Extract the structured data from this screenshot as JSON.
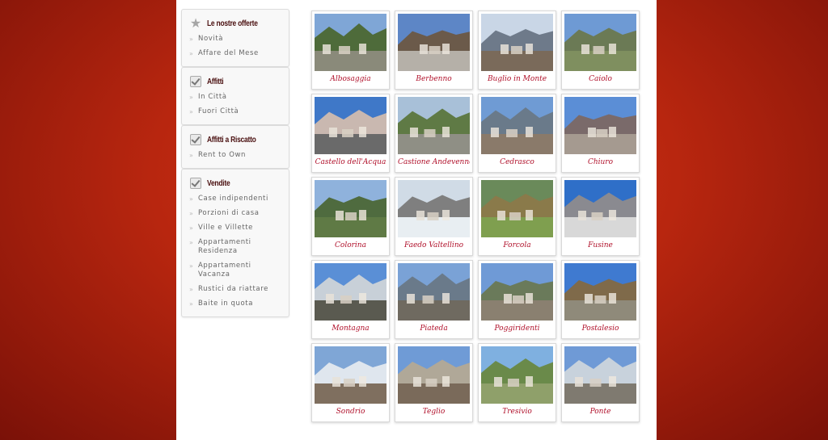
{
  "sidebar": {
    "sections": [
      {
        "icon": "star-icon",
        "title": "Le nostre offerte",
        "items": [
          "Novità",
          "Affare del Mese"
        ]
      },
      {
        "icon": "checkbox-icon",
        "title": "Affitti",
        "items": [
          "In Città",
          "Fuori Città"
        ]
      },
      {
        "icon": "checkbox-icon",
        "title": "Affitti a Riscatto",
        "items": [
          "Rent to Own"
        ]
      },
      {
        "icon": "checkbox-icon",
        "title": "Vendite",
        "items": [
          "Case indipendenti",
          "Porzioni di casa",
          "Ville e Villette",
          "Appartamenti Residenza",
          "Appartamenti Vacanza",
          "Rustici da riattare",
          "Baite in quota"
        ]
      }
    ]
  },
  "towns": [
    {
      "name": "Albosaggia",
      "sky": "#7fa6d6",
      "mid": "#4e6b3a",
      "fg": "#8a8a7a"
    },
    {
      "name": "Berbenno",
      "sky": "#5d86c6",
      "mid": "#6b5a4a",
      "fg": "#b5b0a8"
    },
    {
      "name": "Buglio in Monte",
      "sky": "#c9d6e6",
      "mid": "#6e7a8a",
      "fg": "#7a6a5a"
    },
    {
      "name": "Caiolo",
      "sky": "#6e9ad4",
      "mid": "#6b7a55",
      "fg": "#7f8f5f"
    },
    {
      "name": "Castello dell'Acqua",
      "sky": "#3f78c8",
      "mid": "#c9b8b0",
      "fg": "#6a6a6a"
    },
    {
      "name": "Castione Andevenno",
      "sky": "#a8c0d8",
      "mid": "#5f7a45",
      "fg": "#8f8f85"
    },
    {
      "name": "Cedrasco",
      "sky": "#6f9bd4",
      "mid": "#6a7a8a",
      "fg": "#8a7a6a"
    },
    {
      "name": "Chiuro",
      "sky": "#5b8ed6",
      "mid": "#7a6a6a",
      "fg": "#a59a90"
    },
    {
      "name": "Colorina",
      "sky": "#8fb2dc",
      "mid": "#4f6b3f",
      "fg": "#5f7a45"
    },
    {
      "name": "Faedo Valtellino",
      "sky": "#d0dbe6",
      "mid": "#7f7f7f",
      "fg": "#e8eef2"
    },
    {
      "name": "Forcola",
      "sky": "#6a8a5a",
      "mid": "#8a7a4a",
      "fg": "#7f9f4f"
    },
    {
      "name": "Fusine",
      "sky": "#2f6fc8",
      "mid": "#8a8a90",
      "fg": "#d8d8d8"
    },
    {
      "name": "Montagna",
      "sky": "#5a8fd6",
      "mid": "#c8d0d8",
      "fg": "#5a5a50"
    },
    {
      "name": "Piateda",
      "sky": "#7aa2d6",
      "mid": "#6a7a8a",
      "fg": "#6f6a60"
    },
    {
      "name": "Poggiridenti",
      "sky": "#6f9ad6",
      "mid": "#6a7a5a",
      "fg": "#8a8070"
    },
    {
      "name": "Postalesio",
      "sky": "#3f7ad0",
      "mid": "#7f6a4a",
      "fg": "#8f8a7a"
    },
    {
      "name": "Sondrio",
      "sky": "#7fa6d6",
      "mid": "#dfe6ee",
      "fg": "#7f6f5f"
    },
    {
      "name": "Teglio",
      "sky": "#6f9bd6",
      "mid": "#b0a898",
      "fg": "#7a6a5a"
    },
    {
      "name": "Tresivio",
      "sky": "#7fb0e0",
      "mid": "#6a8a4a",
      "fg": "#8fa06a"
    },
    {
      "name": "Ponte",
      "sky": "#6f9ad6",
      "mid": "#c8d2dc",
      "fg": "#7f7a70"
    }
  ]
}
